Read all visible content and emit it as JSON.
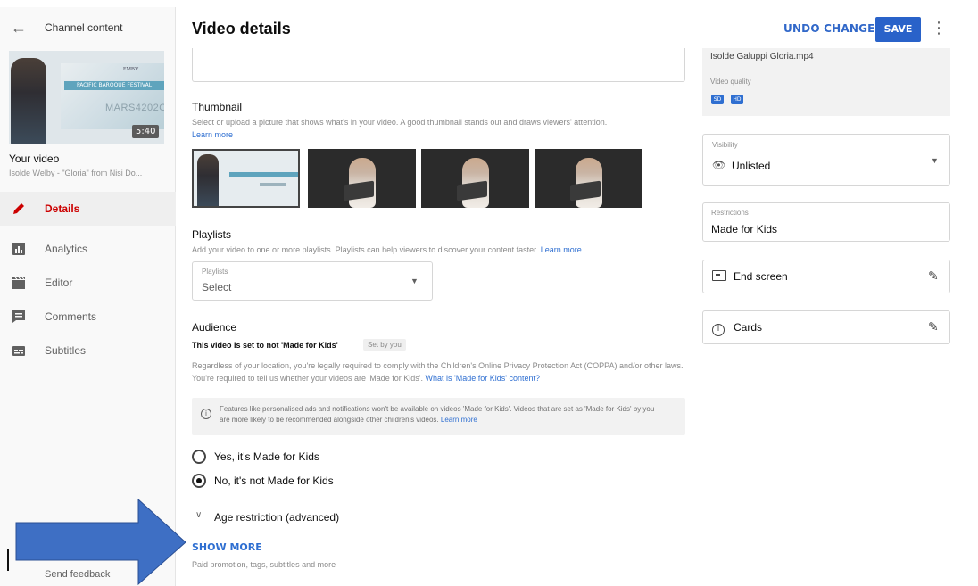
{
  "sidebar": {
    "back_label": "←",
    "title": "Channel content",
    "thumbnail": {
      "duration": "5:40",
      "banner_text": "PACIFIC BAROQUE FESTIVAL",
      "logo_text": "EMBV",
      "date_text": "MARS4202O"
    },
    "your_video_label": "Your video",
    "video_name": "Isolde Welby - \"Gloria\" from Nisi Do...",
    "nav": [
      {
        "id": "details",
        "label": "Details",
        "icon": "pencil-icon",
        "active": true
      },
      {
        "id": "analytics",
        "label": "Analytics",
        "icon": "analytics-icon",
        "active": false
      },
      {
        "id": "editor",
        "label": "Editor",
        "icon": "clapperboard-icon",
        "active": false
      },
      {
        "id": "comments",
        "label": "Comments",
        "icon": "comment-icon",
        "active": false
      },
      {
        "id": "subtitles",
        "label": "Subtitles",
        "icon": "subtitles-icon",
        "active": false
      }
    ],
    "feedback_label": "Send feedback"
  },
  "header": {
    "title": "Video details",
    "undo_label": "UNDO CHANGES",
    "save_label": "SAVE",
    "more_label": "⋮"
  },
  "thumbnail_section": {
    "heading": "Thumbnail",
    "help": "Select or upload a picture that shows what's in your video. A good thumbnail stands out and draws viewers' attention.",
    "learn_more": "Learn more"
  },
  "playlists_section": {
    "heading": "Playlists",
    "help": "Add your video to one or more playlists. Playlists can help viewers to discover your content faster.",
    "learn_more": "Learn more",
    "select_label": "Playlists",
    "select_value": "Select"
  },
  "audience_section": {
    "heading": "Audience",
    "status": "This video is set to not 'Made for Kids'",
    "set_by": "Set by you",
    "help": "Regardless of your location, you're legally required to comply with the Children's Online Privacy Protection Act (COPPA) and/or other laws. You're required to tell us whether your videos are 'Made for Kids'.",
    "help_link": "What is 'Made for Kids' content?",
    "info": "Features like personalised ads and notifications won't be available on videos 'Made for Kids'. Videos that are set as 'Made for Kids' by you are more likely to be recommended alongside other children's videos.",
    "info_link": "Learn more",
    "options": [
      {
        "label": "Yes, it's Made for Kids",
        "selected": false
      },
      {
        "label": "No, it's not Made for Kids",
        "selected": true
      }
    ],
    "age_restriction_label": "Age restriction (advanced)"
  },
  "show_more": {
    "label": "SHOW MORE",
    "help": "Paid promotion, tags, subtitles and more"
  },
  "right_panel": {
    "file_name": "Isolde Galuppi Gloria.mp4",
    "video_quality_label": "Video quality",
    "quality_badges": [
      "SD",
      "HD"
    ],
    "visibility_label": "Visibility",
    "visibility_value": "Unlisted",
    "restrictions_label": "Restrictions",
    "restrictions_value": "Made for Kids",
    "end_screen_label": "End screen",
    "cards_label": "Cards"
  },
  "colors": {
    "accent_blue": "#2962c9",
    "link_blue": "#2f6fd1",
    "active_red": "#cc0000",
    "arrow_blue": "#3e6fc4"
  }
}
